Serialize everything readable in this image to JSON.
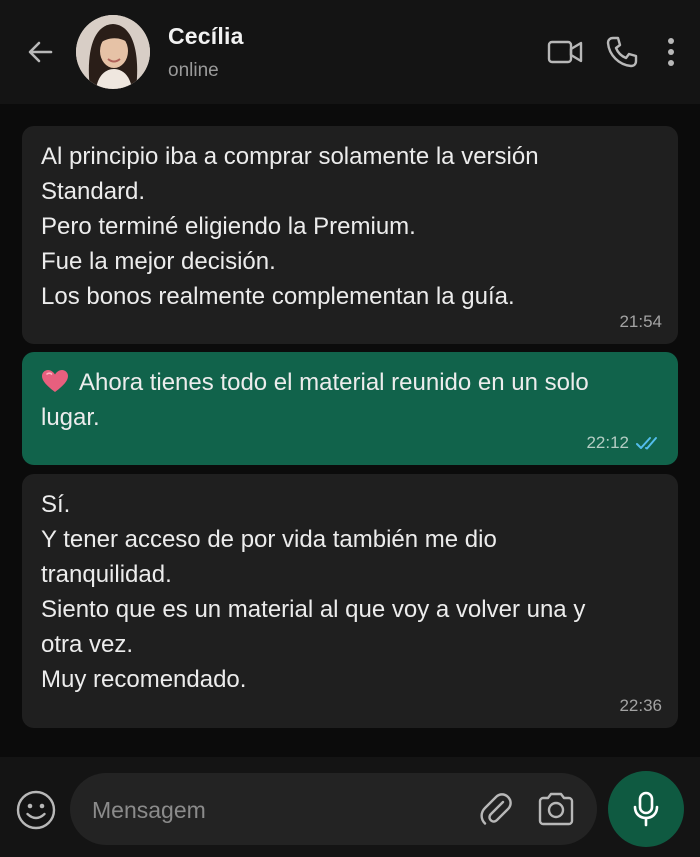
{
  "header": {
    "contact_name": "Cecília",
    "contact_status": "online",
    "icons": [
      "back-arrow-icon",
      "video-call-icon",
      "phone-icon",
      "more-vert-icon"
    ]
  },
  "messages": [
    {
      "direction": "incoming",
      "lines": [
        "Al principio iba a comprar solamente la versión",
        "Standard.",
        "Pero terminé eligiendo la Premium.",
        "Fue la mejor decisión.",
        "Los bonos realmente complementan la guía."
      ],
      "time": "21:54"
    },
    {
      "direction": "outgoing",
      "emoji": "heart-emoji",
      "lines": [
        "Ahora tienes todo el material reunido en un solo",
        "lugar."
      ],
      "time": "22:12",
      "status": "read"
    },
    {
      "direction": "incoming",
      "lines": [
        "Sí.",
        "Y tener acceso de por vida también me dio",
        "tranquilidad.",
        "Siento que es un material al que voy a volver una y",
        "otra vez.",
        "Muy recomendado."
      ],
      "time": "22:36"
    }
  ],
  "composer": {
    "placeholder": "Mensagem",
    "value": ""
  },
  "colors": {
    "incoming_bubble": "#1f1f1f",
    "outgoing_bubble": "#11634b",
    "mic_button": "#0f5a41",
    "read_ticks": "#53bdeb"
  }
}
